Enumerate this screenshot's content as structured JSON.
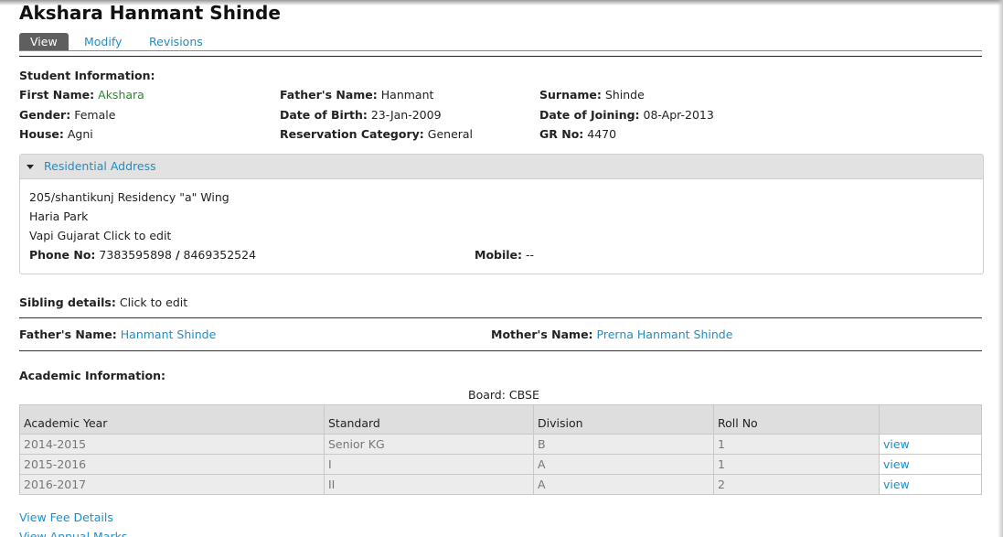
{
  "page": {
    "title": "Akshara Hanmant Shinde"
  },
  "tabs": [
    {
      "label": "View"
    },
    {
      "label": "Modify"
    },
    {
      "label": "Revisions"
    }
  ],
  "student_info": {
    "heading": "Student Information:",
    "first_name_label": "First Name:",
    "first_name": "Akshara",
    "fathers_name_label": "Father's Name:",
    "fathers_name": "Hanmant",
    "surname_label": "Surname:",
    "surname": "Shinde",
    "gender_label": "Gender:",
    "gender": "Female",
    "dob_label": "Date of Birth:",
    "dob": "23-Jan-2009",
    "doj_label": "Date of Joining:",
    "doj": "08-Apr-2013",
    "house_label": "House:",
    "house": "Agni",
    "reservation_label": "Reservation Category:",
    "reservation": "General",
    "gr_label": "GR No:",
    "gr": "4470"
  },
  "address": {
    "title": "Residential Address",
    "line1": "205/shantikunj Residency \"a\" Wing",
    "line2": "Haria Park",
    "line3": "Vapi Gujarat Click to edit",
    "phone_label": "Phone No:",
    "phone1": "7383595898",
    "phone_sep": "/",
    "phone2": "8469352524",
    "mobile_label": "Mobile:",
    "mobile": "--"
  },
  "sibling": {
    "label": "Sibling details:",
    "value": "Click to edit"
  },
  "parents": {
    "father_label": "Father's Name:",
    "father": "Hanmant Shinde",
    "mother_label": "Mother's Name:",
    "mother": "Prerna Hanmant Shinde"
  },
  "academic": {
    "heading": "Academic Information:",
    "board": "Board: CBSE",
    "columns": [
      "Academic Year",
      "Standard",
      "Division",
      "Roll No",
      ""
    ],
    "rows": [
      {
        "year": "2014-2015",
        "standard": "Senior KG",
        "division": "B",
        "roll": "1",
        "action": "view"
      },
      {
        "year": "2015-2016",
        "standard": "I",
        "division": "A",
        "roll": "1",
        "action": "view"
      },
      {
        "year": "2016-2017",
        "standard": "II",
        "division": "A",
        "roll": "2",
        "action": "view"
      }
    ]
  },
  "links": {
    "fee": "View Fee Details",
    "marks": "View Annual Marks"
  }
}
